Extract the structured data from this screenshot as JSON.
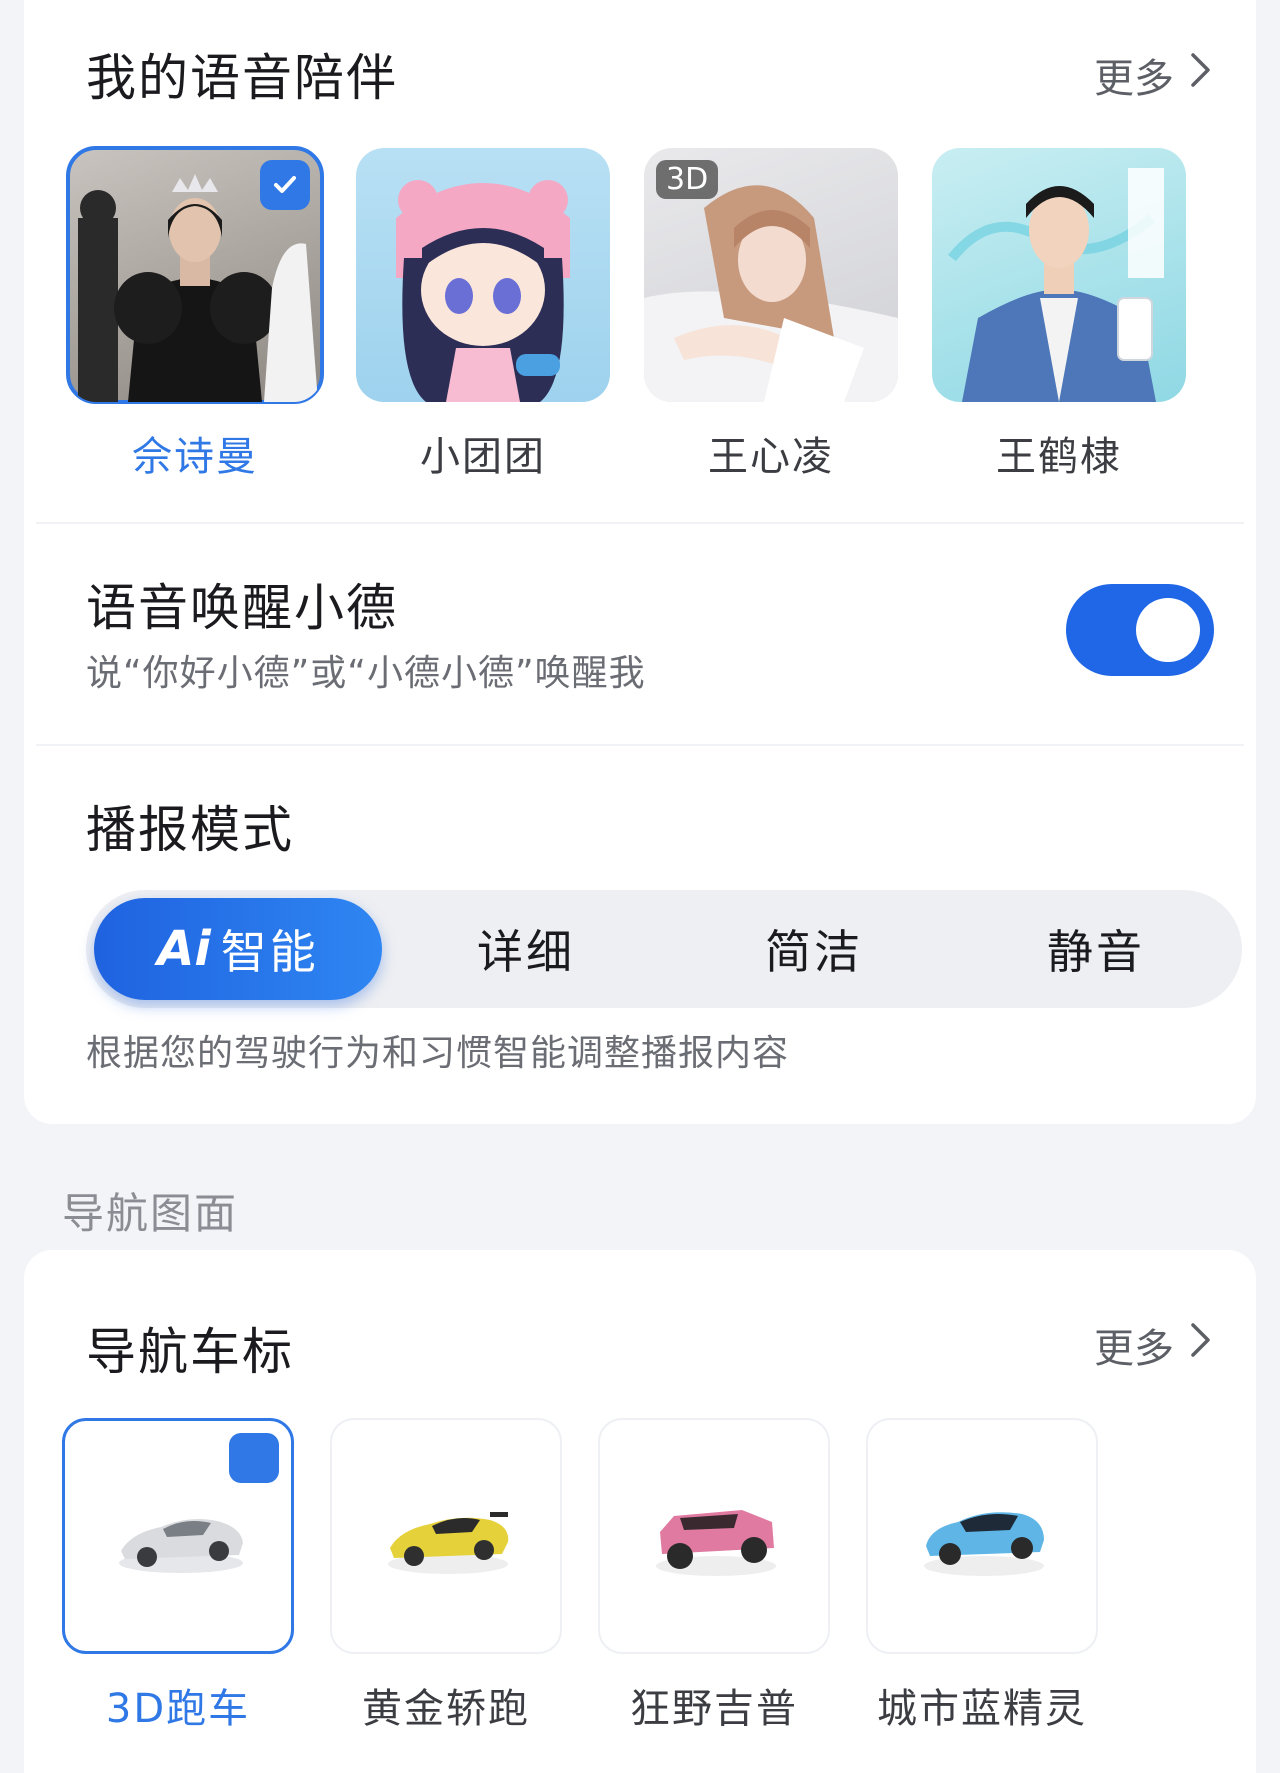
{
  "companion": {
    "title": "我的语音陪伴",
    "more_label": "更多",
    "items": [
      {
        "name": "佘诗曼",
        "selected": true,
        "badge": ""
      },
      {
        "name": "小团团",
        "selected": false,
        "badge": ""
      },
      {
        "name": "王心凌",
        "selected": false,
        "badge": "3D"
      },
      {
        "name": "王鹤棣",
        "selected": false,
        "badge": ""
      }
    ]
  },
  "wake": {
    "title": "语音唤醒小德",
    "subtitle": "说“你好小德”或“小德小德”唤醒我",
    "enabled": true
  },
  "broadcast": {
    "title": "播报模式",
    "ai_mark": "Ai",
    "options": [
      "智能",
      "详细",
      "简洁",
      "静音"
    ],
    "selected": "智能",
    "description": "根据您的驾驶行为和习惯智能调整播报内容"
  },
  "nav_section_label": "导航图面",
  "nav_icon": {
    "title": "导航车标",
    "more_label": "更多",
    "items": [
      {
        "name": "3D跑车",
        "selected": true,
        "color": "#d9dbde"
      },
      {
        "name": "黄金轿跑",
        "selected": false,
        "color": "#e5d13a"
      },
      {
        "name": "狂野吉普",
        "selected": false,
        "color": "#e07aa0"
      },
      {
        "name": "城市蓝精灵",
        "selected": false,
        "color": "#5fb6e6"
      }
    ]
  },
  "colors": {
    "accent": "#2f78e6",
    "toggle_on": "#1f67e6"
  }
}
